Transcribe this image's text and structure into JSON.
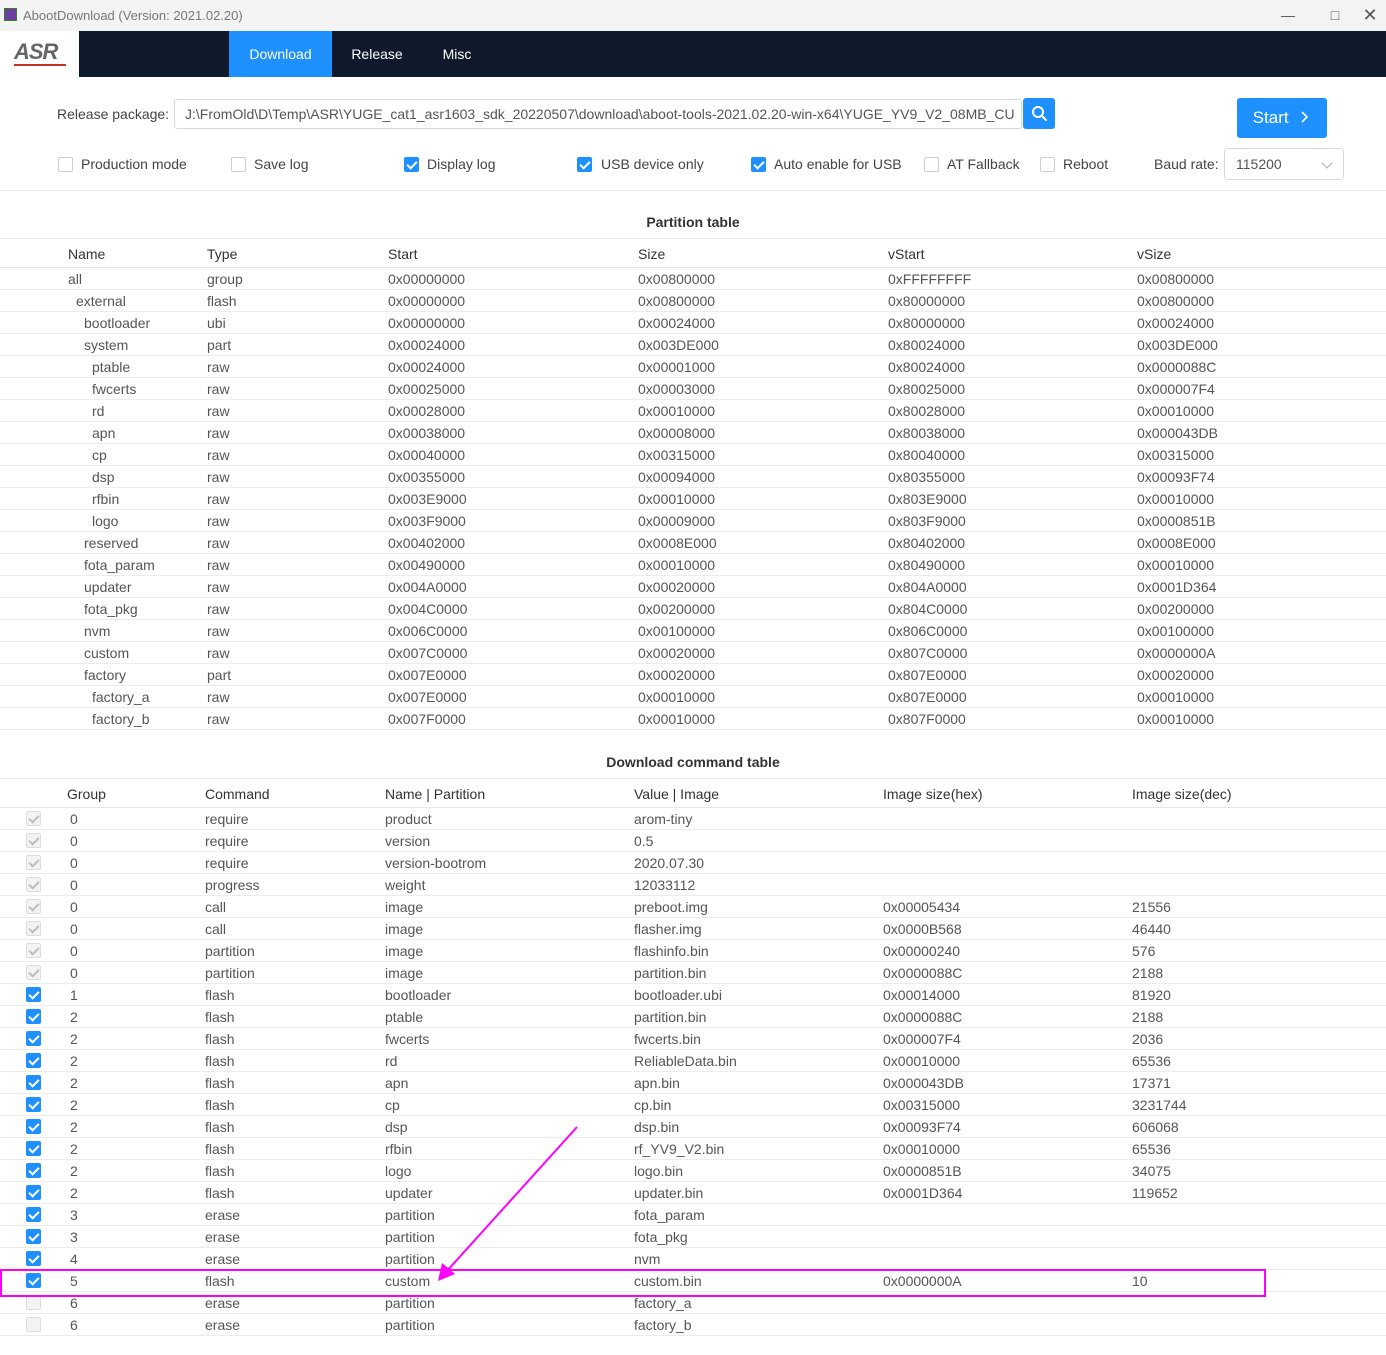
{
  "window": {
    "title": "AbootDownload (Version: 2021.02.20)"
  },
  "nav": {
    "logo": "ASR",
    "tabs": [
      "Download",
      "Release",
      "Misc"
    ]
  },
  "release": {
    "label": "Release package:",
    "path": "J:\\FromOld\\D\\Temp\\ASR\\YUGE_cat1_asr1603_sdk_20220507\\download\\aboot-tools-2021.02.20-win-x64\\YUGE_YV9_V2_08MB_CU",
    "start_label": "Start"
  },
  "options": {
    "checkboxes": [
      {
        "label": "Production mode",
        "checked": false
      },
      {
        "label": "Save log",
        "checked": false
      },
      {
        "label": "Display log",
        "checked": true
      },
      {
        "label": "USB device only",
        "checked": true
      },
      {
        "label": "Auto enable for USB",
        "checked": true
      },
      {
        "label": "AT Fallback",
        "checked": false
      },
      {
        "label": "Reboot",
        "checked": false
      }
    ],
    "baud_label": "Baud rate:",
    "baud_value": "115200"
  },
  "partition_table": {
    "title": "Partition table",
    "headers": [
      "Name",
      "Type",
      "Start",
      "Size",
      "vStart",
      "vSize"
    ],
    "rows": [
      {
        "level": 0,
        "cells": [
          "all",
          "group",
          "0x00000000",
          "0x00800000",
          "0xFFFFFFFF",
          "0x00800000"
        ]
      },
      {
        "level": 1,
        "cells": [
          "external",
          "flash",
          "0x00000000",
          "0x00800000",
          "0x80000000",
          "0x00800000"
        ]
      },
      {
        "level": 2,
        "cells": [
          "bootloader",
          "ubi",
          "0x00000000",
          "0x00024000",
          "0x80000000",
          "0x00024000"
        ]
      },
      {
        "level": 2,
        "cells": [
          "system",
          "part",
          "0x00024000",
          "0x003DE000",
          "0x80024000",
          "0x003DE000"
        ]
      },
      {
        "level": 3,
        "cells": [
          "ptable",
          "raw",
          "0x00024000",
          "0x00001000",
          "0x80024000",
          "0x0000088C"
        ]
      },
      {
        "level": 3,
        "cells": [
          "fwcerts",
          "raw",
          "0x00025000",
          "0x00003000",
          "0x80025000",
          "0x000007F4"
        ]
      },
      {
        "level": 3,
        "cells": [
          "rd",
          "raw",
          "0x00028000",
          "0x00010000",
          "0x80028000",
          "0x00010000"
        ]
      },
      {
        "level": 3,
        "cells": [
          "apn",
          "raw",
          "0x00038000",
          "0x00008000",
          "0x80038000",
          "0x000043DB"
        ]
      },
      {
        "level": 3,
        "cells": [
          "cp",
          "raw",
          "0x00040000",
          "0x00315000",
          "0x80040000",
          "0x00315000"
        ]
      },
      {
        "level": 3,
        "cells": [
          "dsp",
          "raw",
          "0x00355000",
          "0x00094000",
          "0x80355000",
          "0x00093F74"
        ]
      },
      {
        "level": 3,
        "cells": [
          "rfbin",
          "raw",
          "0x003E9000",
          "0x00010000",
          "0x803E9000",
          "0x00010000"
        ]
      },
      {
        "level": 3,
        "cells": [
          "logo",
          "raw",
          "0x003F9000",
          "0x00009000",
          "0x803F9000",
          "0x0000851B"
        ]
      },
      {
        "level": 2,
        "cells": [
          "reserved",
          "raw",
          "0x00402000",
          "0x0008E000",
          "0x80402000",
          "0x0008E000"
        ]
      },
      {
        "level": 2,
        "cells": [
          "fota_param",
          "raw",
          "0x00490000",
          "0x00010000",
          "0x80490000",
          "0x00010000"
        ]
      },
      {
        "level": 2,
        "cells": [
          "updater",
          "raw",
          "0x004A0000",
          "0x00020000",
          "0x804A0000",
          "0x0001D364"
        ]
      },
      {
        "level": 2,
        "cells": [
          "fota_pkg",
          "raw",
          "0x004C0000",
          "0x00200000",
          "0x804C0000",
          "0x00200000"
        ]
      },
      {
        "level": 2,
        "cells": [
          "nvm",
          "raw",
          "0x006C0000",
          "0x00100000",
          "0x806C0000",
          "0x00100000"
        ]
      },
      {
        "level": 2,
        "cells": [
          "custom",
          "raw",
          "0x007C0000",
          "0x00020000",
          "0x807C0000",
          "0x0000000A"
        ]
      },
      {
        "level": 2,
        "cells": [
          "factory",
          "part",
          "0x007E0000",
          "0x00020000",
          "0x807E0000",
          "0x00020000"
        ]
      },
      {
        "level": 3,
        "cells": [
          "factory_a",
          "raw",
          "0x007E0000",
          "0x00010000",
          "0x807E0000",
          "0x00010000"
        ]
      },
      {
        "level": 3,
        "cells": [
          "factory_b",
          "raw",
          "0x007F0000",
          "0x00010000",
          "0x807F0000",
          "0x00010000"
        ]
      }
    ]
  },
  "command_table": {
    "title": "Download command table",
    "headers": [
      "Group",
      "Command",
      "Name | Partition",
      "Value | Image",
      "Image size(hex)",
      "Image size(dec)"
    ],
    "rows": [
      {
        "state": "disabled-checked",
        "cells": [
          "0",
          "require",
          "product",
          "arom-tiny",
          "",
          ""
        ]
      },
      {
        "state": "disabled-checked",
        "cells": [
          "0",
          "require",
          "version",
          "0.5",
          "",
          ""
        ]
      },
      {
        "state": "disabled-checked",
        "cells": [
          "0",
          "require",
          "version-bootrom",
          "2020.07.30",
          "",
          ""
        ]
      },
      {
        "state": "disabled-checked",
        "cells": [
          "0",
          "progress",
          "weight",
          "12033112",
          "",
          ""
        ]
      },
      {
        "state": "disabled-checked",
        "cells": [
          "0",
          "call",
          "image",
          "preboot.img",
          "0x00005434",
          "21556"
        ]
      },
      {
        "state": "disabled-checked",
        "cells": [
          "0",
          "call",
          "image",
          "flasher.img",
          "0x0000B568",
          "46440"
        ]
      },
      {
        "state": "disabled-checked",
        "cells": [
          "0",
          "partition",
          "image",
          "flashinfo.bin",
          "0x00000240",
          "576"
        ]
      },
      {
        "state": "disabled-checked",
        "cells": [
          "0",
          "partition",
          "image",
          "partition.bin",
          "0x0000088C",
          "2188"
        ]
      },
      {
        "state": "checked",
        "cells": [
          "1",
          "flash",
          "bootloader",
          "bootloader.ubi",
          "0x00014000",
          "81920"
        ]
      },
      {
        "state": "checked",
        "cells": [
          "2",
          "flash",
          "ptable",
          "partition.bin",
          "0x0000088C",
          "2188"
        ]
      },
      {
        "state": "checked",
        "cells": [
          "2",
          "flash",
          "fwcerts",
          "fwcerts.bin",
          "0x000007F4",
          "2036"
        ]
      },
      {
        "state": "checked",
        "cells": [
          "2",
          "flash",
          "rd",
          "ReliableData.bin",
          "0x00010000",
          "65536"
        ]
      },
      {
        "state": "checked",
        "cells": [
          "2",
          "flash",
          "apn",
          "apn.bin",
          "0x000043DB",
          "17371"
        ]
      },
      {
        "state": "checked",
        "cells": [
          "2",
          "flash",
          "cp",
          "cp.bin",
          "0x00315000",
          "3231744"
        ]
      },
      {
        "state": "checked",
        "cells": [
          "2",
          "flash",
          "dsp",
          "dsp.bin",
          "0x00093F74",
          "606068"
        ]
      },
      {
        "state": "checked",
        "cells": [
          "2",
          "flash",
          "rfbin",
          "rf_YV9_V2.bin",
          "0x00010000",
          "65536"
        ]
      },
      {
        "state": "checked",
        "cells": [
          "2",
          "flash",
          "logo",
          "logo.bin",
          "0x0000851B",
          "34075"
        ]
      },
      {
        "state": "checked",
        "cells": [
          "2",
          "flash",
          "updater",
          "updater.bin",
          "0x0001D364",
          "119652"
        ]
      },
      {
        "state": "checked",
        "cells": [
          "3",
          "erase",
          "partition",
          "fota_param",
          "",
          ""
        ]
      },
      {
        "state": "checked",
        "cells": [
          "3",
          "erase",
          "partition",
          "fota_pkg",
          "",
          ""
        ]
      },
      {
        "state": "checked",
        "cells": [
          "4",
          "erase",
          "partition",
          "nvm",
          "",
          ""
        ]
      },
      {
        "state": "checked",
        "cells": [
          "5",
          "flash",
          "custom",
          "custom.bin",
          "0x0000000A",
          "10"
        ]
      },
      {
        "state": "disabled-unchecked",
        "cells": [
          "6",
          "erase",
          "partition",
          "factory_a",
          "",
          ""
        ]
      },
      {
        "state": "disabled-unchecked",
        "cells": [
          "6",
          "erase",
          "partition",
          "factory_b",
          "",
          ""
        ]
      }
    ]
  },
  "annotation": {
    "color": "#ff00ff",
    "highlighted_row": "custom"
  },
  "colors": {
    "accent": "#1f90ff",
    "navbar": "#0e1a2b",
    "annotation": "#ff00ff"
  }
}
